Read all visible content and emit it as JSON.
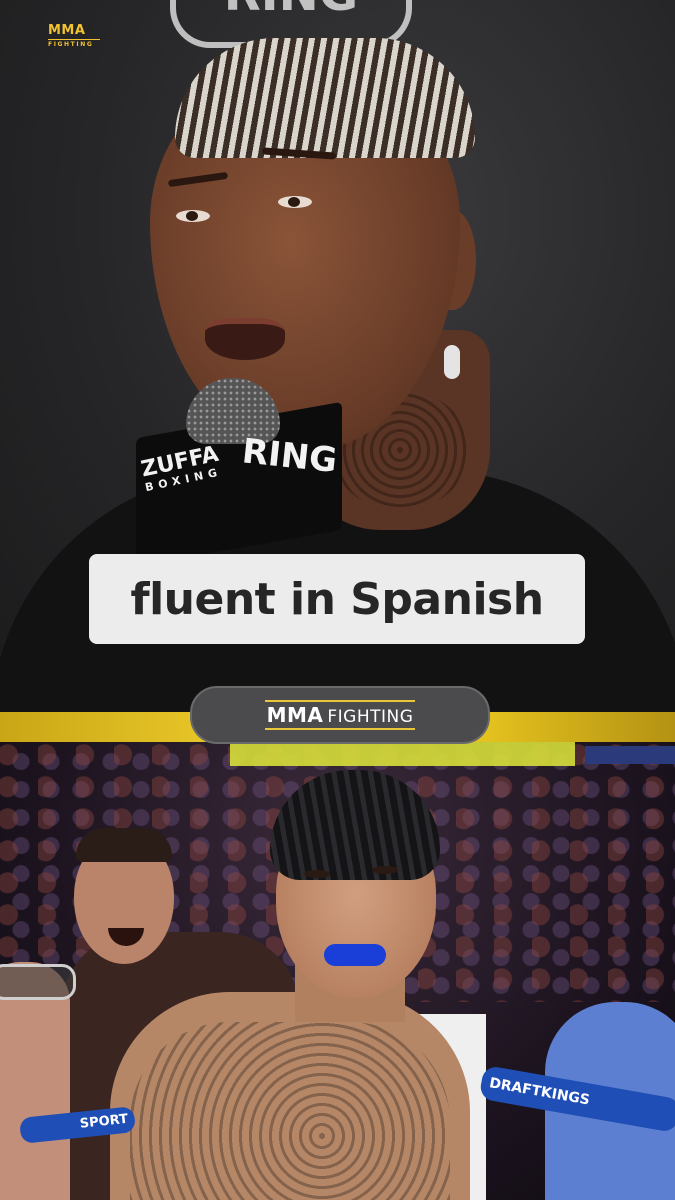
{
  "top_panel": {
    "backdrop_logo": "RING",
    "corner_badge": {
      "line1": "MMA",
      "line2": "FIGHTING"
    },
    "mic_flag": {
      "brand_left": "ZUFFA",
      "brand_left_sub": "BOXING",
      "brand_right": "RING"
    },
    "caption": "fluent in Spanish"
  },
  "divider": {
    "brand": {
      "part1": "MMA",
      "part2": "FIGHTING"
    }
  },
  "bottom_panel": {
    "rope_left_text": "SPORT",
    "rope_right_text": "DRAFTKINGS"
  },
  "colors": {
    "accent_yellow": "#f0cf2d",
    "caption_bg": "#ececec",
    "brand_pill_bg": "#4b4b4d",
    "mouthguard_blue": "#1a3ed8",
    "rope_blue": "#1f4fb6"
  }
}
